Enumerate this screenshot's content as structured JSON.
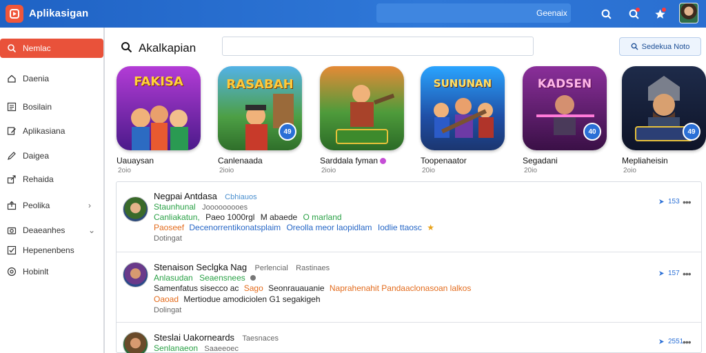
{
  "app": {
    "title": "Aplikasigan"
  },
  "topbar": {
    "search_label": "Geenaix"
  },
  "sidebar": {
    "items": [
      {
        "label": "Nemlac",
        "icon": "search-icon",
        "active": true
      },
      {
        "label": "Daenia",
        "icon": "home-icon"
      },
      {
        "label": "Bosilain",
        "icon": "list-icon"
      },
      {
        "label": "Aplikasiana",
        "icon": "edit-icon"
      },
      {
        "label": "Daigea",
        "icon": "pencil-icon"
      },
      {
        "label": "Rehaida",
        "icon": "share-icon"
      },
      {
        "label": "Peolika",
        "icon": "upload-icon",
        "chevron": "›"
      },
      {
        "label": "Deaeanhes",
        "icon": "camera-icon",
        "chevron": "⌄"
      },
      {
        "label": "Hepenenbens",
        "icon": "checkbox-icon"
      },
      {
        "label": "Hobinlt",
        "icon": "info-icon"
      }
    ]
  },
  "search": {
    "title": "Akalkapian",
    "button_label": "Sedekua Noto"
  },
  "featured": [
    {
      "name": "Uauaysan",
      "sub": "2oio",
      "art": "FAKISA"
    },
    {
      "name": "Canlenaada",
      "sub": "2ioio",
      "art": "RASABAH",
      "badge": "49"
    },
    {
      "name": "Sarddala fyman",
      "sub": "2ioio",
      "art": ""
    },
    {
      "name": "Toopenaator",
      "sub": "20io",
      "art": "SUNUNAN"
    },
    {
      "name": "Segadani",
      "sub": "20io",
      "art": "KADSEN",
      "badge": "40"
    },
    {
      "name": "Mepliaheisin",
      "sub": "2oio",
      "art": "",
      "badge": "49"
    }
  ],
  "list": [
    {
      "title": "Negpai Antdasa",
      "tag": "Cbhiauos",
      "line2a": "Staunhunal",
      "line2b": "Jooooooooes",
      "line3a": "Canliakatun,",
      "line3b": "Paeo 1000rgl",
      "line3c": "M abaede",
      "line3d": "O marland",
      "line4a": "Paoseef",
      "line4b": "Decenorrentikonatsplaim",
      "line4c": "Oreolla meor laopidlam",
      "line4d": "Iodlie ttaosc",
      "line5": "Dotingat",
      "count": "153"
    },
    {
      "title": "Stenaison Seclgka Nag",
      "tag": "Perlencial",
      "tag2": "Rastinaes",
      "line2a": "Anlasudan",
      "line2b": "Seaensnees",
      "line3a": "Samenfatus sisecco ac",
      "line3b": "Sago",
      "line3c": "Seonrauauanie",
      "line3d": "Naprahenahit Pandaaclonasoan lalkos",
      "line4a": "Oaoad",
      "line4b": "Mertiodue amodiciolen G1 segakigeh",
      "line5": "Dolingat",
      "count": "157"
    },
    {
      "title": "Steslai Uakorneards",
      "tag": "Taesnaces",
      "line2a": "Senlanaeon",
      "line2b": "Saaeeoec",
      "count": "2551"
    }
  ]
}
